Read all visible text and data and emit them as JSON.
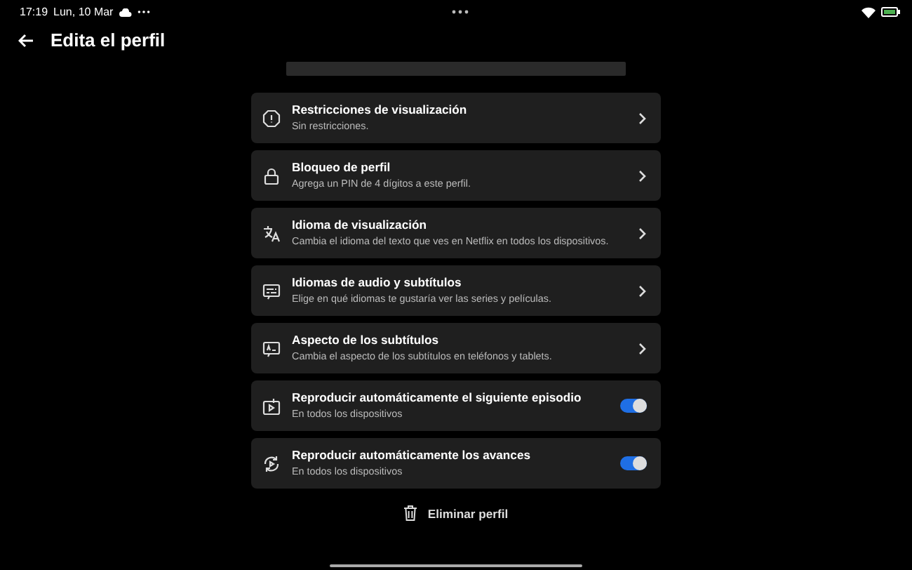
{
  "status_bar": {
    "time": "17:19",
    "date": "Lun, 10 Mar"
  },
  "header": {
    "title": "Edita el perfil"
  },
  "settings": [
    {
      "kind": "link",
      "title": "Restricciones de visualización",
      "subtitle": "Sin restricciones."
    },
    {
      "kind": "link",
      "title": "Bloqueo de perfil",
      "subtitle": "Agrega un PIN de 4 dígitos a este perfil."
    },
    {
      "kind": "link",
      "title": "Idioma de visualización",
      "subtitle": "Cambia el idioma del texto que ves en Netflix en todos los dispositivos."
    },
    {
      "kind": "link",
      "title": "Idiomas de audio y subtítulos",
      "subtitle": "Elige en qué idiomas te gustaría ver las series y películas."
    },
    {
      "kind": "link",
      "title": "Aspecto de los subtítulos",
      "subtitle": "Cambia el aspecto de los subtítulos en teléfonos y tablets."
    },
    {
      "kind": "toggle",
      "title": "Reproducir automáticamente el siguiente episodio",
      "subtitle": "En todos los dispositivos",
      "on": true
    },
    {
      "kind": "toggle",
      "title": "Reproducir automáticamente los avances",
      "subtitle": "En todos los dispositivos",
      "on": true
    }
  ],
  "delete_button": {
    "label": "Eliminar perfil"
  }
}
